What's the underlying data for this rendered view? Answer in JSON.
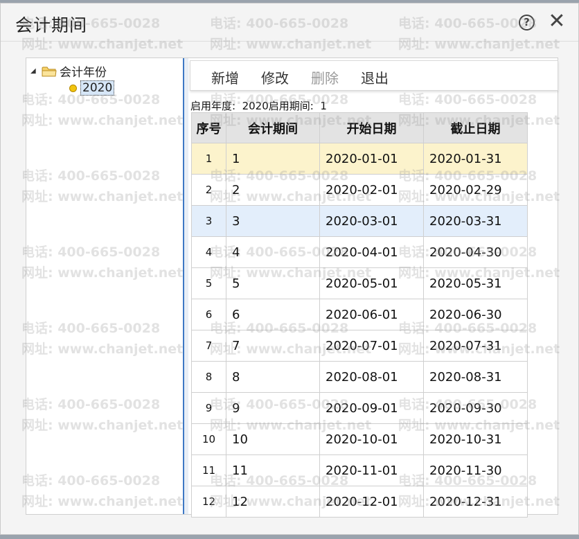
{
  "window": {
    "title": "会计期间",
    "help_glyph": "?",
    "close_glyph": "✕"
  },
  "tree": {
    "root_label": "会计年份",
    "child_label": "2020"
  },
  "toolbar": {
    "add_label": "新增",
    "edit_label": "修改",
    "delete_label": "删除",
    "exit_label": "退出"
  },
  "info": {
    "line": "启用年度:  2020启用期间:  1"
  },
  "grid": {
    "headers": [
      "序号",
      "会计期间",
      "开始日期",
      "截止日期"
    ],
    "rows": [
      {
        "idx": "1",
        "period": "1",
        "start": "2020-01-01",
        "end": "2020-01-31"
      },
      {
        "idx": "2",
        "period": "2",
        "start": "2020-02-01",
        "end": "2020-02-29"
      },
      {
        "idx": "3",
        "period": "3",
        "start": "2020-03-01",
        "end": "2020-03-31"
      },
      {
        "idx": "4",
        "period": "4",
        "start": "2020-04-01",
        "end": "2020-04-30"
      },
      {
        "idx": "5",
        "period": "5",
        "start": "2020-05-01",
        "end": "2020-05-31"
      },
      {
        "idx": "6",
        "period": "6",
        "start": "2020-06-01",
        "end": "2020-06-30"
      },
      {
        "idx": "7",
        "period": "7",
        "start": "2020-07-01",
        "end": "2020-07-31"
      },
      {
        "idx": "8",
        "period": "8",
        "start": "2020-08-01",
        "end": "2020-08-31"
      },
      {
        "idx": "9",
        "period": "9",
        "start": "2020-09-01",
        "end": "2020-09-30"
      },
      {
        "idx": "10",
        "period": "10",
        "start": "2020-10-01",
        "end": "2020-10-31"
      },
      {
        "idx": "11",
        "period": "11",
        "start": "2020-11-01",
        "end": "2020-11-30"
      },
      {
        "idx": "12",
        "period": "12",
        "start": "2020-12-01",
        "end": "2020-12-31"
      }
    ]
  },
  "watermark": {
    "phone": "电话: 400-665-0028",
    "site": "网址: www.chanjet.net"
  },
  "colors": {
    "edit_row": "#fcf3cc",
    "selected_row": "#e3eefb",
    "splitter": "#3d78c4"
  }
}
